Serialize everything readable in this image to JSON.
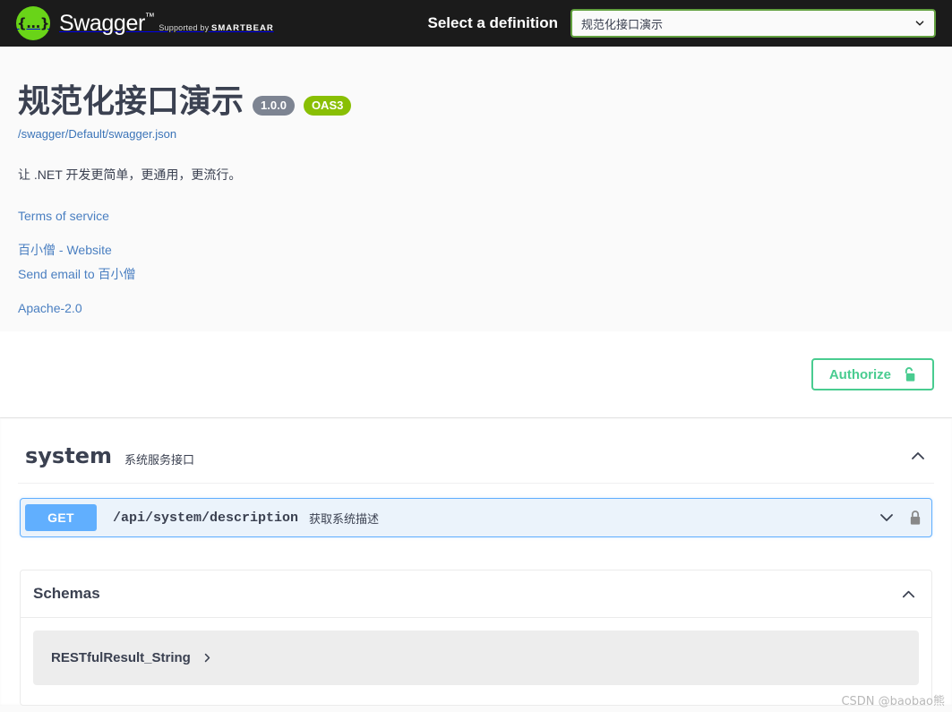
{
  "topbar": {
    "logo": {
      "glyph": "{...}",
      "title": "Swagger",
      "trademark": "™",
      "supported_prefix": "Supported by",
      "supported_brand": "SMARTBEAR"
    },
    "select_label": "Select a definition",
    "definition_value": "规范化接口演示",
    "chevron_icon": "chevron-down-icon",
    "colors": {
      "background": "#1b1b1b",
      "logo_green": "#69d418",
      "select_border": "#62a03f"
    }
  },
  "info": {
    "title": "规范化接口演示",
    "version_badge": "1.0.0",
    "spec_badge": "OAS3",
    "url": "/swagger/Default/swagger.json",
    "description": "让 .NET 开发更简单，更通用，更流行。",
    "links": [
      {
        "label": "Terms of service",
        "name": "terms-of-service-link"
      },
      {
        "label": "百小僧 - Website",
        "name": "contact-website-link"
      },
      {
        "label": "Send email to 百小僧",
        "name": "contact-email-link"
      },
      {
        "label": "Apache-2.0",
        "name": "license-link"
      }
    ],
    "colors": {
      "version_badge": "#7d8492",
      "spec_badge": "#89bf04",
      "link": "#4a7fc1"
    }
  },
  "auth": {
    "authorize_label": "Authorize",
    "lock_icon": "unlocked-padlock-icon",
    "accent": "#49cc90"
  },
  "tags": [
    {
      "name": "system",
      "description": "系统服务接口",
      "collapse_icon": "chevron-up-icon",
      "operations": [
        {
          "method": "GET",
          "path": "/api/system/description",
          "summary": "获取系统描述",
          "expand_icon": "chevron-down-icon",
          "auth_icon": "locked-padlock-icon",
          "method_color": "#61affe"
        }
      ]
    }
  ],
  "schemas": {
    "title": "Schemas",
    "collapse_icon": "chevron-up-icon",
    "models": [
      {
        "name": "RESTfulResult_String",
        "expand_icon": "chevron-right-icon"
      }
    ]
  },
  "watermark": "CSDN @baobao熊"
}
